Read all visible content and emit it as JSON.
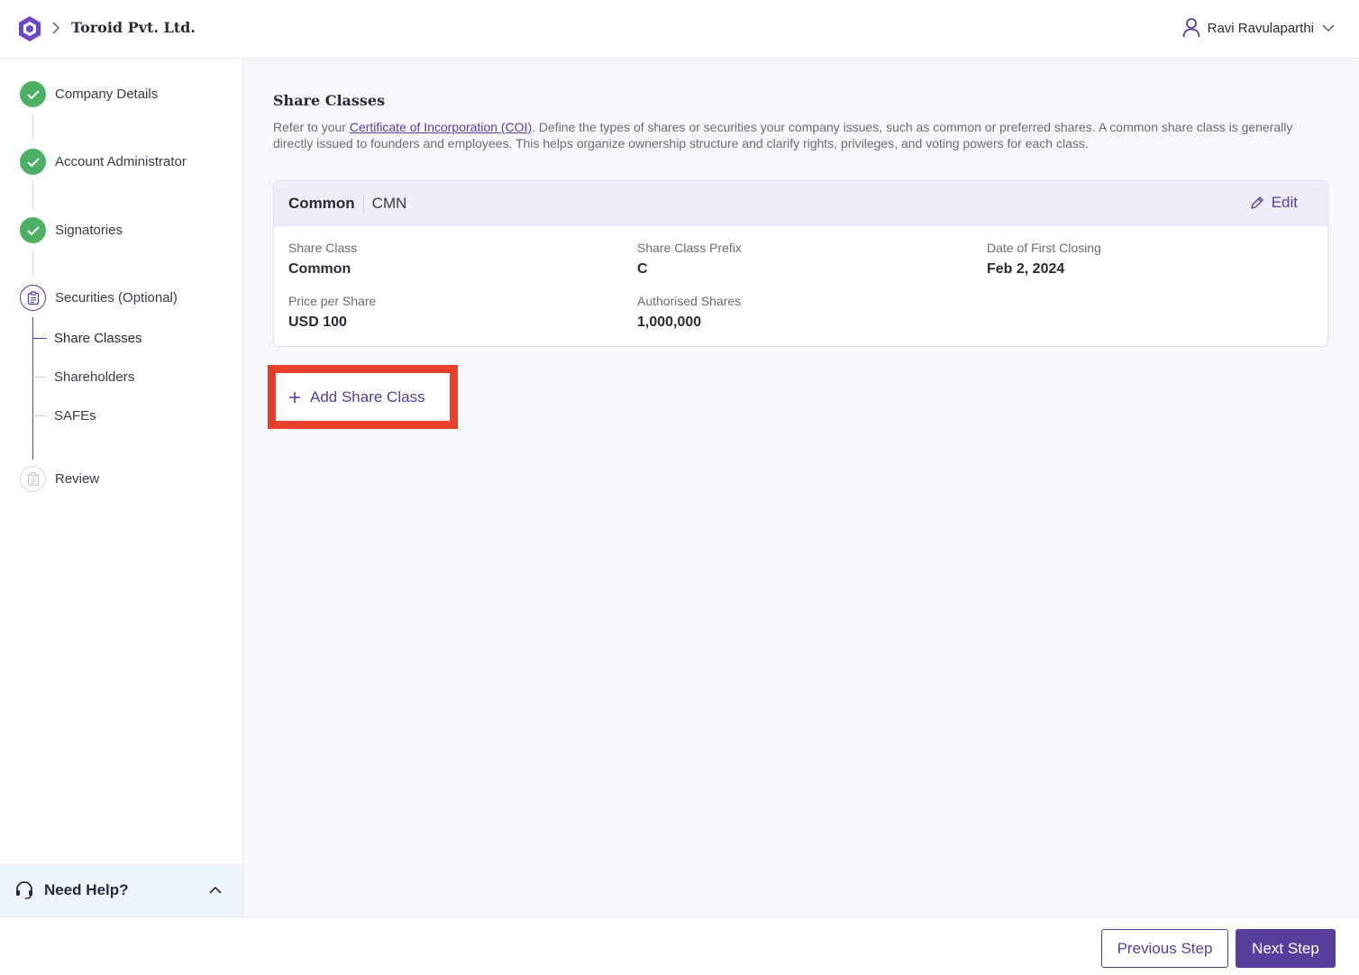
{
  "header": {
    "company": "Toroid Pvt. Ltd.",
    "user": "Ravi Ravulaparthi"
  },
  "sidebar": {
    "steps": [
      {
        "label": "Company Details",
        "status": "done"
      },
      {
        "label": "Account Administrator",
        "status": "done"
      },
      {
        "label": "Signatories",
        "status": "done"
      },
      {
        "label": "Securities (Optional)",
        "status": "active"
      },
      {
        "label": "Review",
        "status": "pending"
      }
    ],
    "substeps": [
      {
        "label": "Share Classes",
        "current": true
      },
      {
        "label": "Shareholders",
        "current": false
      },
      {
        "label": "SAFEs",
        "current": false
      }
    ],
    "help_label": "Need Help?"
  },
  "main": {
    "title": "Share Classes",
    "desc_prefix": "Refer to your ",
    "desc_link": "Certificate of Incorporation (COI)",
    "desc_suffix": ". Define the types of shares or securities your company issues, such as common or preferred shares. A common share class is generally directly issued to founders and employees. This helps organize ownership structure and clarify rights, privileges, and voting powers for each class.",
    "card": {
      "name": "Common",
      "code": "CMN",
      "edit_label": "Edit",
      "fields": {
        "share_class": {
          "label": "Share Class",
          "value": "Common"
        },
        "prefix": {
          "label": "Share Class Prefix",
          "value": "C"
        },
        "first_closing": {
          "label": "Date of First Closing",
          "value": "Feb 2, 2024"
        },
        "price": {
          "label": "Price per Share",
          "value": "USD 100"
        },
        "authorised": {
          "label": "Authorised Shares",
          "value": "1,000,000"
        }
      }
    },
    "add_label": "Add Share Class"
  },
  "footer": {
    "prev_label": "Previous Step",
    "next_label": "Next Step"
  },
  "colors": {
    "accent": "#5a3e9e",
    "success": "#4caf63",
    "highlight": "#e8402a"
  }
}
